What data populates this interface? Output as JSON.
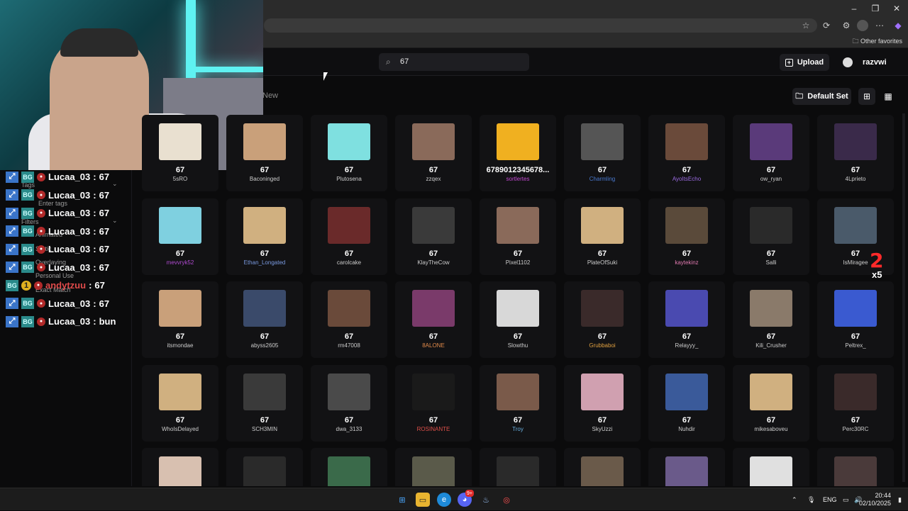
{
  "browser": {
    "favorites_label": "Other favorites",
    "window_controls": [
      "–",
      "❐",
      "✕"
    ]
  },
  "app": {
    "search_value": "67",
    "upload_label": "Upload",
    "username": "razvwi",
    "new_tab_label": "New",
    "set_label": "Default Set"
  },
  "sidebar_ghost": {
    "tags": "Tags",
    "enter_tags": "Enter tags",
    "filters": "Filters",
    "animated": "Animated",
    "static": "Static",
    "overlaying": "Overlaying",
    "personal_use": "Personal Use",
    "exact_match": "Exact Match"
  },
  "chat": [
    {
      "user": "Lucaa_03",
      "msg": "67",
      "color": "#ffffff",
      "special": false
    },
    {
      "user": "Lucaa_03",
      "msg": "67",
      "color": "#ffffff",
      "special": false
    },
    {
      "user": "Lucaa_03",
      "msg": "67",
      "color": "#ffffff",
      "special": false
    },
    {
      "user": "Lucaa_03",
      "msg": "67",
      "color": "#ffffff",
      "special": false
    },
    {
      "user": "Lucaa_03",
      "msg": "67",
      "color": "#ffffff",
      "special": false
    },
    {
      "user": "Lucaa_03",
      "msg": "67",
      "color": "#ffffff",
      "special": false
    },
    {
      "user": "andytzuu",
      "msg": "67",
      "color": "#e04a4a",
      "special": true
    },
    {
      "user": "Lucaa_03",
      "msg": "67",
      "color": "#ffffff",
      "special": false
    },
    {
      "user": "Lucaa_03",
      "msg": "bun",
      "color": "#ffffff",
      "special": false
    }
  ],
  "emotes": [
    {
      "name": "67",
      "user": "5sRO",
      "ucolor": "#cccccc",
      "tcolor": "#e9e0d0"
    },
    {
      "name": "67",
      "user": "Baconinged",
      "ucolor": "#cccccc",
      "tcolor": "#c9a07a"
    },
    {
      "name": "67",
      "user": "Plutosena",
      "ucolor": "#cccccc",
      "tcolor": "#7fe0e0"
    },
    {
      "name": "67",
      "user": "zzqex",
      "ucolor": "#cccccc",
      "tcolor": "#8a6a5a"
    },
    {
      "name": "6789012345678...",
      "user": "sortlertes",
      "ucolor": "#c34ad1",
      "tcolor": "#f0b020"
    },
    {
      "name": "67",
      "user": "Charmling",
      "ucolor": "#4a7ad1",
      "tcolor": "#555555"
    },
    {
      "name": "67",
      "user": "AyoItsEcho",
      "ucolor": "#9a6ae0",
      "tcolor": "#6a4a3a"
    },
    {
      "name": "67",
      "user": "ow_ryan",
      "ucolor": "#cccccc",
      "tcolor": "#5a3a7a"
    },
    {
      "name": "67",
      "user": "4Lprieto",
      "ucolor": "#cccccc",
      "tcolor": "#3a2a4a"
    },
    {
      "name": "67",
      "user": "mevvryk52",
      "ucolor": "#b04ad1",
      "tcolor": "#7fd0e0"
    },
    {
      "name": "67",
      "user": "Ethan_Longated",
      "ucolor": "#7a9ae0",
      "tcolor": "#d0b080"
    },
    {
      "name": "67",
      "user": "carolcake",
      "ucolor": "#cccccc",
      "tcolor": "#6a2a2a"
    },
    {
      "name": "67",
      "user": "KlayTheCow",
      "ucolor": "#cccccc",
      "tcolor": "#3a3a3a"
    },
    {
      "name": "67",
      "user": "Pixel1102",
      "ucolor": "#cccccc",
      "tcolor": "#8a6a5a"
    },
    {
      "name": "67",
      "user": "PlateOfSuki",
      "ucolor": "#cccccc",
      "tcolor": "#d0b080"
    },
    {
      "name": "67",
      "user": "kaytekinz",
      "ucolor": "#e07ab0",
      "tcolor": "#5a4a3a"
    },
    {
      "name": "67",
      "user": "Salli",
      "ucolor": "#cccccc",
      "tcolor": "#2a2a2a"
    },
    {
      "name": "67",
      "user": "IsMiragee",
      "ucolor": "#cccccc",
      "tcolor": "#4a5a6a"
    },
    {
      "name": "67",
      "user": "itsmondae",
      "ucolor": "#cccccc",
      "tcolor": "#c9a07a"
    },
    {
      "name": "67",
      "user": "abyss2605",
      "ucolor": "#cccccc",
      "tcolor": "#3a4a6a"
    },
    {
      "name": "67",
      "user": "rm47008",
      "ucolor": "#cccccc",
      "tcolor": "#6a4a3a"
    },
    {
      "name": "67",
      "user": "8ALONE",
      "ucolor": "#e08a4a",
      "tcolor": "#7a3a6a"
    },
    {
      "name": "67",
      "user": "Slowthu",
      "ucolor": "#cccccc",
      "tcolor": "#d8d8d8"
    },
    {
      "name": "67",
      "user": "Grubbaboi",
      "ucolor": "#e0a040",
      "tcolor": "#3a2a2a"
    },
    {
      "name": "67",
      "user": "Relayyy_",
      "ucolor": "#cccccc",
      "tcolor": "#4a4ab0"
    },
    {
      "name": "67",
      "user": "Kili_Crusher",
      "ucolor": "#cccccc",
      "tcolor": "#8a7a6a"
    },
    {
      "name": "67",
      "user": "Peltrex_",
      "ucolor": "#cccccc",
      "tcolor": "#3a5ad0"
    },
    {
      "name": "67",
      "user": "WhoIsDelayed",
      "ucolor": "#cccccc",
      "tcolor": "#d0b080"
    },
    {
      "name": "67",
      "user": "SCH3MIN",
      "ucolor": "#cccccc",
      "tcolor": "#3a3a3a"
    },
    {
      "name": "67",
      "user": "dwa_3133",
      "ucolor": "#cccccc",
      "tcolor": "#4a4a4a"
    },
    {
      "name": "67",
      "user": "ROSINANTE",
      "ucolor": "#e0504a",
      "tcolor": "#1a1a1a"
    },
    {
      "name": "67",
      "user": "Troy",
      "ucolor": "#6ab0e0",
      "tcolor": "#7a5a4a"
    },
    {
      "name": "67",
      "user": "SkyUzzi",
      "ucolor": "#cccccc",
      "tcolor": "#d0a0b0"
    },
    {
      "name": "67",
      "user": "Nuhdir",
      "ucolor": "#cccccc",
      "tcolor": "#3a5a9a"
    },
    {
      "name": "67",
      "user": "mikesaboveu",
      "ucolor": "#cccccc",
      "tcolor": "#d0b080"
    },
    {
      "name": "67",
      "user": "Perc30RC",
      "ucolor": "#cccccc",
      "tcolor": "#3a2a2a"
    },
    {
      "name": "",
      "user": "",
      "ucolor": "#cccccc",
      "tcolor": "#d8c0b0"
    },
    {
      "name": "",
      "user": "",
      "ucolor": "#cccccc",
      "tcolor": "#2a2a2a"
    },
    {
      "name": "",
      "user": "",
      "ucolor": "#cccccc",
      "tcolor": "#3a6a4a"
    },
    {
      "name": "",
      "user": "",
      "ucolor": "#cccccc",
      "tcolor": "#5a5a4a"
    },
    {
      "name": "",
      "user": "",
      "ucolor": "#cccccc",
      "tcolor": "#2a2a2a"
    },
    {
      "name": "",
      "user": "",
      "ucolor": "#cccccc",
      "tcolor": "#6a5a4a"
    },
    {
      "name": "",
      "user": "",
      "ucolor": "#cccccc",
      "tcolor": "#6a5a8a"
    },
    {
      "name": "",
      "user": "",
      "ucolor": "#cccccc",
      "tcolor": "#e0e0e0"
    },
    {
      "name": "",
      "user": "",
      "ucolor": "#cccccc",
      "tcolor": "#4a3a3a"
    }
  ],
  "overlay": {
    "combo_count": "2",
    "combo_multiplier": "x5"
  },
  "taskbar": {
    "lang": "ENG",
    "time": "20:44",
    "date": "02/10/2025",
    "discord_badge": "9+"
  }
}
